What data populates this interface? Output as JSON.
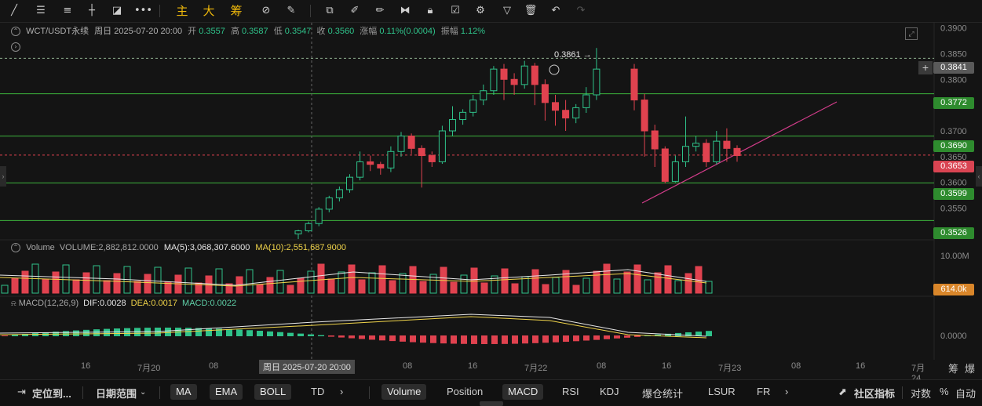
{
  "toolbar": {
    "tools": [
      "line-tool-icon",
      "horizontal-lines-icon",
      "parallel-lines-icon",
      "cross-line-icon",
      "shape-icon",
      "more-dots-icon"
    ],
    "cn_buttons": [
      "主",
      "大",
      "筹"
    ],
    "tools2": [
      "magnet-icon",
      "brush-off-icon",
      "copy-icon",
      "ruler-icon",
      "eraser-icon",
      "indicator-icon",
      "lock-icon",
      "edit-note-icon",
      "tune-icon",
      "filter-icon",
      "trash-icon",
      "undo-icon",
      "redo-icon"
    ]
  },
  "header": {
    "symbol": "WCT/USDT永续",
    "period": "周日 2025-07-20 20:00",
    "open_label": "开",
    "open": "0.3557",
    "high_label": "高",
    "high": "0.3587",
    "low_label": "低",
    "low": "0.3547",
    "close_label": "收",
    "close": "0.3560",
    "change_label": "涨幅",
    "change": "0.11%(0.0004)",
    "amp_label": "振幅",
    "amp": "1.12%"
  },
  "price_axis": {
    "ticks": [
      "0.3900",
      "0.3850",
      "0.3800",
      "0.3750",
      "0.3700",
      "0.3650",
      "0.3600",
      "0.3550",
      "0.3500"
    ],
    "min": 0.349,
    "max": 0.391
  },
  "levels": {
    "l1": "0.3841",
    "l2": "0.3772",
    "l3": "0.3690",
    "l4": "0.3653",
    "l5": "0.3599",
    "l6": "0.3526"
  },
  "high_marker": "0.3861 →",
  "volume": {
    "label": "Volume",
    "volume_text": "VOLUME:2,882,812.0000",
    "ma5": "MA(5):3,068,307.6000",
    "ma10": "MA(10):2,551,687.9000",
    "axis_top": "10.00M",
    "current": "614.0k"
  },
  "macd": {
    "label": "MACD(12,26,9)",
    "dif": "DIF:0.0028",
    "dea": "DEA:0.0017",
    "macd": "MACD:0.0022",
    "axis_zero": "0.0000"
  },
  "time_axis": {
    "labels": [
      "16",
      "7月20",
      "08",
      "16",
      "7月22",
      "08",
      "16",
      "7月23",
      "08",
      "16",
      "7月24"
    ],
    "selected": "周日 2025-07-20 20:00",
    "right_labels": [
      "筹",
      "爆"
    ]
  },
  "bottom": {
    "goto": "定位到...",
    "range": "日期范围",
    "indicators_main": [
      "MA",
      "EMA",
      "BOLL",
      "TD"
    ],
    "indicators_sub": [
      "Volume",
      "Position",
      "MACD",
      "RSI",
      "KDJ",
      "爆仓统计",
      "LSUR",
      "FR"
    ],
    "community": "社区指标",
    "log": "对数",
    "percent": "%",
    "auto": "自动"
  },
  "colors": {
    "up": "#2fc28a",
    "down": "#e0424f",
    "level_green": "#3cb43c",
    "trend": "#d23c8a",
    "ma5": "#e8e8e8",
    "ma10": "#f0d44a"
  }
}
